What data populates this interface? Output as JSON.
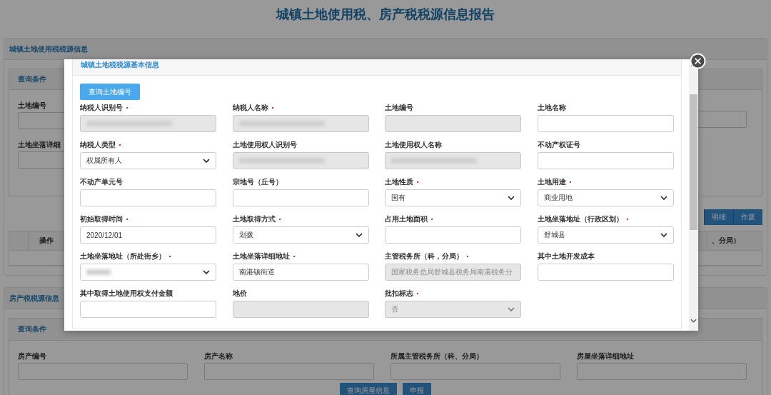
{
  "page_title": "城镇土地使用税、房产税税源信息报告",
  "land_panel": {
    "title": "城镇土地使用税税源信息",
    "query_title": "查询条件",
    "fields": [
      {
        "label": "土地编号"
      },
      {
        "label": "土地坐落详细"
      }
    ],
    "actions": [
      {
        "label": "明细"
      },
      {
        "label": "作废"
      }
    ],
    "table": {
      "columns": [
        "",
        "操作",
        "、分局）"
      ]
    }
  },
  "house_panel": {
    "title": "房产税税源信息",
    "query_title": "查询条件",
    "fields": [
      {
        "label": "房产编号"
      },
      {
        "label": "房产名称"
      },
      {
        "label": "所属主管税务所（科、分局）"
      },
      {
        "label": "房屋坐落详细地址"
      }
    ],
    "actions": [
      {
        "label": "查询房屋信息"
      },
      {
        "label": "申报"
      }
    ]
  },
  "dialog": {
    "section_title": "城镇土地税税源基本信息",
    "query_button": "查询土地编号",
    "fields": [
      {
        "label": "纳税人识别号",
        "required": true,
        "kind": "text",
        "disabled": true,
        "blurred": true
      },
      {
        "label": "纳税人名称",
        "required": true,
        "kind": "text",
        "disabled": true,
        "blurred": true
      },
      {
        "label": "土地编号",
        "required": false,
        "kind": "text",
        "disabled": true,
        "blurred": false
      },
      {
        "label": "土地名称",
        "required": false,
        "kind": "text",
        "disabled": false,
        "blurred": false
      },
      {
        "label": "纳税人类型",
        "required": true,
        "kind": "select",
        "disabled": false,
        "blurred": false,
        "value": "权属所有人"
      },
      {
        "label": "土地使用权人识别号",
        "required": false,
        "kind": "text",
        "disabled": true,
        "blurred": true
      },
      {
        "label": "土地使用权人名称",
        "required": false,
        "kind": "text",
        "disabled": true,
        "blurred": true
      },
      {
        "label": "不动产权证号",
        "required": false,
        "kind": "text",
        "disabled": false,
        "blurred": false
      },
      {
        "label": "不动产单元号",
        "required": false,
        "kind": "text",
        "disabled": false,
        "blurred": false
      },
      {
        "label": "宗地号（丘号）",
        "required": false,
        "kind": "text",
        "disabled": false,
        "blurred": false
      },
      {
        "label": "土地性质",
        "required": true,
        "kind": "select",
        "disabled": false,
        "blurred": false,
        "value": "国有"
      },
      {
        "label": "土地用途",
        "required": true,
        "kind": "select",
        "disabled": false,
        "blurred": false,
        "value": "商业用地"
      },
      {
        "label": "初始取得时间",
        "required": true,
        "kind": "text",
        "disabled": false,
        "blurred": false,
        "value": "2020/12/01"
      },
      {
        "label": "土地取得方式",
        "required": true,
        "kind": "select",
        "disabled": false,
        "blurred": false,
        "value": "划拨"
      },
      {
        "label": "占用土地面积",
        "required": true,
        "kind": "text",
        "disabled": false,
        "blurred": false
      },
      {
        "label": "土地坐落地址（行政区划）",
        "required": true,
        "kind": "select",
        "disabled": false,
        "blurred": false,
        "value": "舒城县"
      },
      {
        "label": "土地坐落地址（所处街乡）",
        "required": true,
        "kind": "select",
        "disabled": false,
        "blurred": true
      },
      {
        "label": "土地坐落详细地址",
        "required": true,
        "kind": "text",
        "disabled": false,
        "blurred": false,
        "value": "南港镇街道"
      },
      {
        "label": "主管税务所（科，分局）",
        "required": true,
        "kind": "text",
        "disabled": true,
        "blurred": false,
        "value": "国家税务总局舒城县税务局南港税务分"
      },
      {
        "label": "其中土地开发成本",
        "required": false,
        "kind": "text",
        "disabled": false,
        "blurred": false
      },
      {
        "label": "其中取得土地使用权支付金额",
        "required": false,
        "kind": "text",
        "disabled": false,
        "blurred": false
      },
      {
        "label": "地价",
        "required": false,
        "kind": "text",
        "disabled": true,
        "blurred": false
      },
      {
        "label": "批扣标志",
        "required": true,
        "kind": "select",
        "disabled": true,
        "blurred": false,
        "value": "否"
      }
    ]
  }
}
